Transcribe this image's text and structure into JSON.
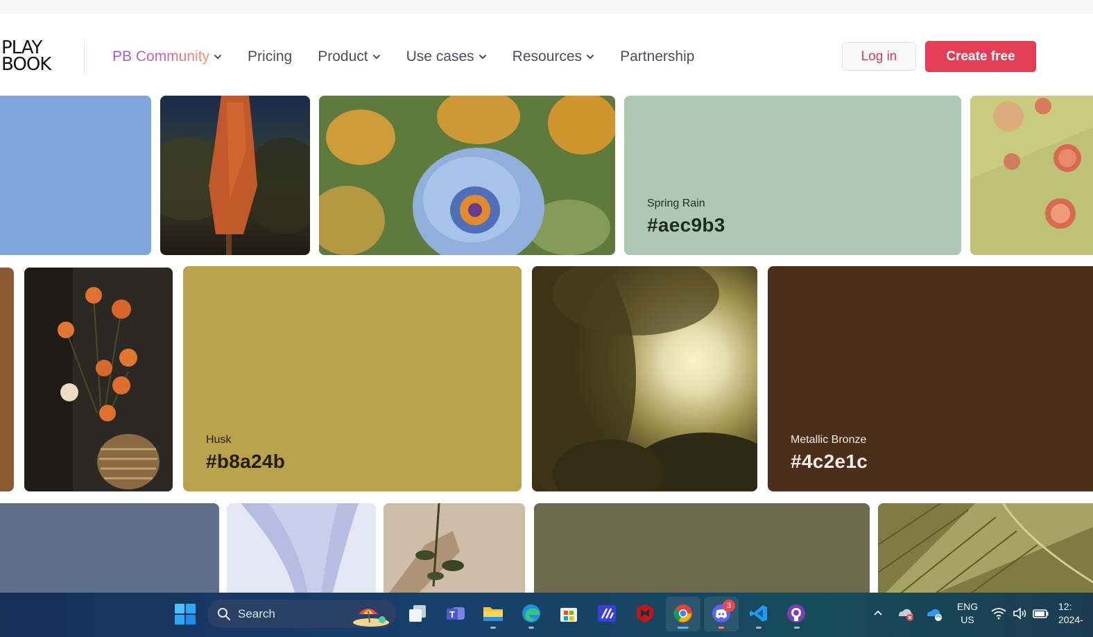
{
  "brand": {
    "logo_line1": "PLAY",
    "logo_line2": "BOOK"
  },
  "nav": {
    "community": "PB Community",
    "pricing": "Pricing",
    "product": "Product",
    "use_cases": "Use cases",
    "resources": "Resources",
    "partnership": "Partnership"
  },
  "actions": {
    "login": "Log in",
    "create": "Create free"
  },
  "swatches": [
    {
      "name": "Spring Rain",
      "hex": "#aec9b3"
    },
    {
      "name": "Husk",
      "hex": "#b8a24b"
    },
    {
      "name": "Metallic Bronze",
      "hex": "#4c2e1c"
    }
  ],
  "colors": {
    "accent": "#e63d56",
    "nav_text": "#4a4e60",
    "tile_blue": "#7fa6dc",
    "tile_slate": "#5f6f89",
    "tile_olive": "#6e6a4f",
    "tile_brown_edge": "#8a5a34"
  },
  "taskbar": {
    "search_label": "Search",
    "discord_badge": "3",
    "lang_line1": "ENG",
    "lang_line2": "US",
    "time": "12:",
    "date": "2024-"
  },
  "icons": {
    "chevron": "chevron-down-icon",
    "start": "windows-start-icon",
    "search": "search-icon",
    "task_view": "task-view-icon",
    "teams": "teams-icon",
    "explorer": "file-explorer-icon",
    "edge": "edge-icon",
    "store": "store-icon",
    "app": "app-icon",
    "mcafee": "mcafee-icon",
    "chrome": "chrome-icon",
    "discord": "discord-icon",
    "vscode": "vscode-icon",
    "github": "github-icon",
    "wifi": "wifi-icon",
    "volume": "volume-icon",
    "battery": "battery-icon"
  }
}
